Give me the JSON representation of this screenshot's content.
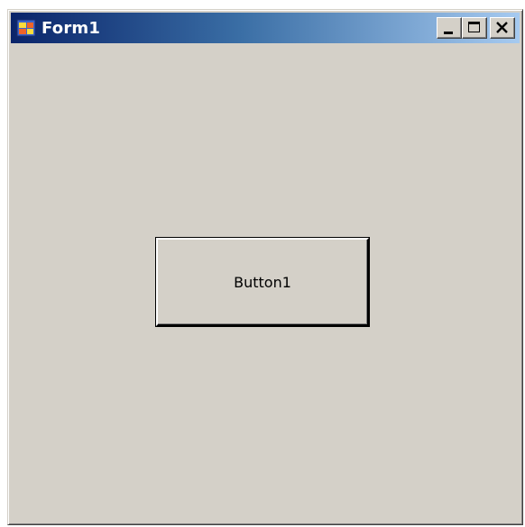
{
  "window": {
    "title": "Form1",
    "icon": "form-app-icon",
    "controls": {
      "minimize_icon": "minimize-icon",
      "maximize_icon": "maximize-icon",
      "close_icon": "close-icon"
    }
  },
  "form": {
    "button1_label": "Button1"
  },
  "colors": {
    "face": "#d4d0c8",
    "titlebar_start": "#0a246a",
    "titlebar_end": "#a6caf0"
  }
}
